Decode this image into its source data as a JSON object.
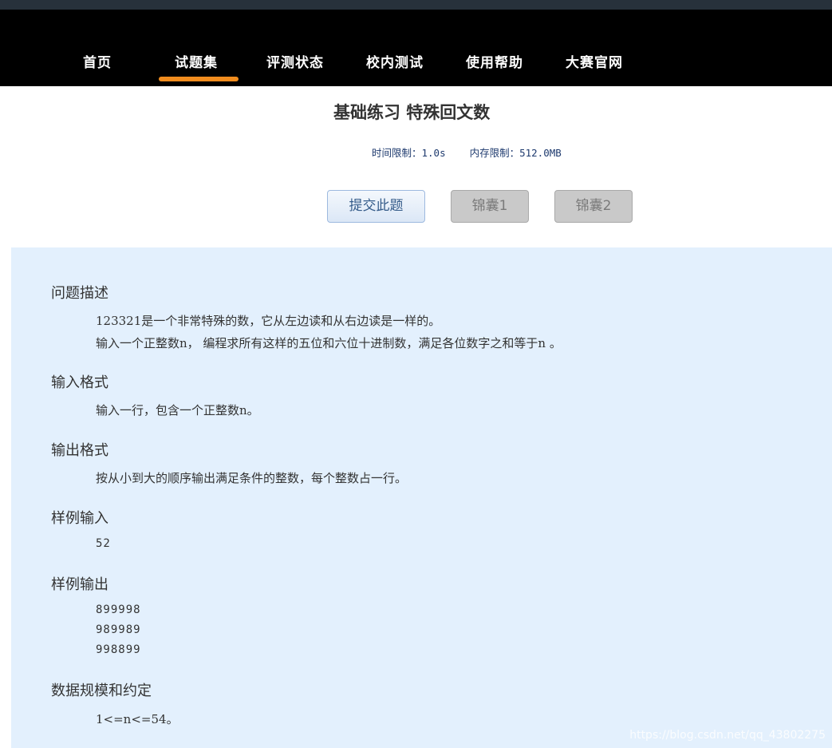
{
  "nav": {
    "items": [
      {
        "label": "首页"
      },
      {
        "label": "试题集"
      },
      {
        "label": "评测状态"
      },
      {
        "label": "校内测试"
      },
      {
        "label": "使用帮助"
      },
      {
        "label": "大赛官网"
      }
    ],
    "active_index": 1,
    "accent_color": "#f08c1e"
  },
  "problem": {
    "title": "基础练习 特殊回文数",
    "time_limit": "时间限制：1.0s",
    "memory_limit": "内存限制：512.0MB"
  },
  "buttons": {
    "submit": "提交此题",
    "hint1": "锦囊1",
    "hint2": "锦囊2"
  },
  "sections": {
    "description": {
      "title": "问题描述",
      "lines": [
        "123321是一个非常特殊的数，它从左边读和从右边读是一样的。",
        "输入一个正整数n， 编程求所有这样的五位和六位十进制数，满足各位数字之和等于n 。"
      ]
    },
    "input_format": {
      "title": "输入格式",
      "text": "输入一行，包含一个正整数n。"
    },
    "output_format": {
      "title": "输出格式",
      "text": "按从小到大的顺序输出满足条件的整数，每个整数占一行。"
    },
    "sample_input": {
      "title": "样例输入",
      "lines": [
        "52"
      ]
    },
    "sample_output": {
      "title": "样例输出",
      "lines": [
        "899998",
        "989989",
        "998899"
      ]
    },
    "constraints": {
      "title": "数据规模和约定",
      "text": "1<=n<=54。"
    }
  },
  "watermark": "https://blog.csdn.net/qq_43802275"
}
